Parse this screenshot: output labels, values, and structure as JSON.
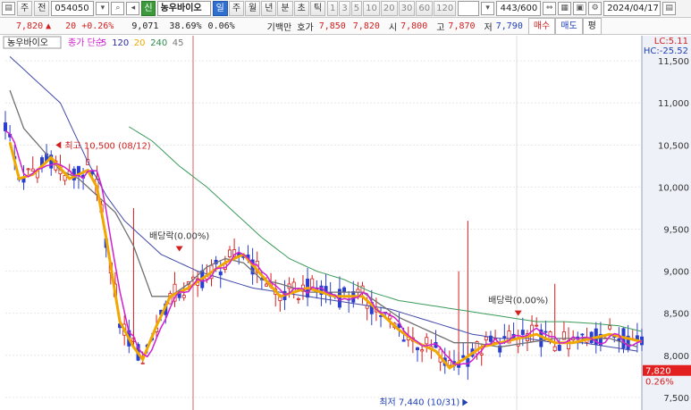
{
  "toolbar": {
    "period_btn": "주",
    "ago_btn": "전",
    "code": "054050",
    "name": "농우바이오",
    "tag": "신",
    "periods": [
      "일",
      "주",
      "월",
      "년",
      "분",
      "초",
      "틱"
    ],
    "selected_period": "일",
    "nums": [
      "1",
      "3",
      "5",
      "10",
      "20",
      "30",
      "60",
      "120"
    ],
    "count": "443/600",
    "date": "2024/04/17"
  },
  "quote": {
    "price": "7,820",
    "arrow": "▲",
    "change": "20",
    "change_pct": "+0.26%",
    "volume": "9,071",
    "turnover": "38.69%",
    "ratio": "0.06%",
    "ask_label": "기백만 호가",
    "ask1": "7,850",
    "ask2": "7,820",
    "open_label": "시",
    "open": "7,800",
    "high_label": "고",
    "high": "7,870",
    "low_label": "저",
    "low": "7,790",
    "buy": "매수",
    "sell": "매도",
    "avg": "평"
  },
  "colors": {
    "up": "#d21f1f",
    "down": "#2a3fd0",
    "ma5": "#d020d0",
    "ma20": "#f0a800",
    "ma120": "#2a2a9a",
    "ma240": "#5a5a5a",
    "ma45": "#2e8a4a",
    "price_badge": "#e32020"
  },
  "chart_data": {
    "type": "candlestick",
    "legend": {
      "name": "농우바이오",
      "items": [
        {
          "label": "종가 단순",
          "color": "#d020d0"
        },
        {
          "label": "5",
          "color": "#d020d0"
        },
        {
          "label": "120",
          "color": "#2a2a9a"
        },
        {
          "label": "20",
          "color": "#f0a800"
        },
        {
          "label": "240",
          "color": "#2e8a4a"
        },
        {
          "label": "45",
          "color": "#777777"
        }
      ]
    },
    "ylim": [
      7350,
      11650
    ],
    "yticks": [
      7500,
      8000,
      8500,
      9000,
      9500,
      10000,
      10500,
      11000,
      11500
    ],
    "ytick_labels": [
      "7,500",
      "8,000",
      "8,500",
      "9,000",
      "9,500",
      "10,000",
      "10,500",
      "11,000",
      "11,500"
    ],
    "lc": "LC:5.11",
    "hc": "HC:-25.52",
    "current_price": "7,820",
    "current_pct": "0.26%",
    "current_value": 7820,
    "high_label": "최고 10,500 (08/12)",
    "high_value": 10500,
    "low_label": "최저 7,440 (10/31)",
    "low_value": 7440,
    "dividend1": "배당락(0.00%)",
    "dividend1_value": 9150,
    "dividend2": "배당락(0.00%)",
    "dividend2_value": 8320,
    "ma_anchor_points": {
      "ma5_ma20": [
        [
          0,
          10750
        ],
        [
          3,
          10100
        ],
        [
          6,
          10150
        ],
        [
          10,
          10350
        ],
        [
          14,
          10100
        ],
        [
          18,
          10200
        ],
        [
          20,
          10000
        ],
        [
          22,
          9400
        ],
        [
          25,
          8400
        ],
        [
          28,
          8100
        ],
        [
          30,
          7950
        ],
        [
          33,
          8350
        ],
        [
          36,
          8700
        ],
        [
          40,
          8800
        ],
        [
          44,
          8950
        ],
        [
          48,
          9100
        ],
        [
          52,
          9200
        ],
        [
          56,
          8950
        ],
        [
          60,
          8700
        ],
        [
          66,
          8800
        ],
        [
          72,
          8700
        ],
        [
          78,
          8700
        ],
        [
          82,
          8500
        ],
        [
          86,
          8300
        ],
        [
          90,
          8150
        ],
        [
          94,
          8050
        ],
        [
          97,
          7850
        ],
        [
          100,
          7950
        ],
        [
          104,
          8100
        ],
        [
          108,
          8150
        ],
        [
          112,
          8200
        ],
        [
          116,
          8250
        ],
        [
          120,
          8150
        ],
        [
          124,
          8150
        ],
        [
          128,
          8200
        ],
        [
          132,
          8250
        ],
        [
          136,
          8200
        ],
        [
          140,
          8150
        ]
      ],
      "ma45": [
        [
          0,
          11300
        ],
        [
          4,
          10700
        ],
        [
          8,
          10450
        ],
        [
          12,
          10200
        ],
        [
          16,
          10100
        ],
        [
          20,
          9900
        ],
        [
          24,
          9700
        ],
        [
          28,
          9300
        ],
        [
          32,
          8700
        ],
        [
          36,
          8700
        ],
        [
          40,
          8850
        ],
        [
          44,
          9050
        ],
        [
          48,
          9150
        ],
        [
          52,
          9100
        ],
        [
          56,
          8900
        ],
        [
          60,
          8850
        ],
        [
          66,
          8750
        ],
        [
          72,
          8750
        ],
        [
          78,
          8750
        ],
        [
          82,
          8600
        ],
        [
          86,
          8450
        ],
        [
          90,
          8350
        ],
        [
          94,
          8250
        ],
        [
          98,
          8150
        ],
        [
          102,
          8150
        ],
        [
          108,
          8100
        ],
        [
          114,
          8150
        ],
        [
          120,
          8200
        ],
        [
          126,
          8200
        ],
        [
          132,
          8200
        ],
        [
          138,
          8100
        ]
      ],
      "ma120": [
        [
          0,
          11600
        ],
        [
          6,
          11300
        ],
        [
          12,
          11000
        ],
        [
          18,
          10300
        ],
        [
          22,
          9900
        ],
        [
          26,
          9600
        ],
        [
          30,
          9400
        ],
        [
          34,
          9200
        ],
        [
          38,
          9100
        ],
        [
          42,
          9000
        ],
        [
          48,
          8900
        ],
        [
          54,
          8800
        ],
        [
          60,
          8750
        ],
        [
          66,
          8700
        ],
        [
          72,
          8650
        ],
        [
          78,
          8600
        ],
        [
          84,
          8550
        ],
        [
          90,
          8450
        ],
        [
          96,
          8350
        ],
        [
          102,
          8250
        ],
        [
          108,
          8200
        ],
        [
          114,
          8200
        ],
        [
          120,
          8150
        ],
        [
          126,
          8150
        ],
        [
          132,
          8100
        ],
        [
          138,
          8050
        ]
      ],
      "ma240": [
        [
          26,
          10750
        ],
        [
          32,
          10550
        ],
        [
          38,
          10250
        ],
        [
          44,
          10000
        ],
        [
          50,
          9700
        ],
        [
          56,
          9400
        ],
        [
          62,
          9150
        ],
        [
          68,
          9000
        ],
        [
          74,
          8900
        ],
        [
          80,
          8750
        ],
        [
          86,
          8650
        ],
        [
          92,
          8600
        ],
        [
          98,
          8550
        ],
        [
          104,
          8500
        ],
        [
          110,
          8450
        ],
        [
          116,
          8400
        ],
        [
          122,
          8400
        ],
        [
          128,
          8380
        ],
        [
          134,
          8350
        ],
        [
          140,
          8270
        ]
      ]
    }
  }
}
